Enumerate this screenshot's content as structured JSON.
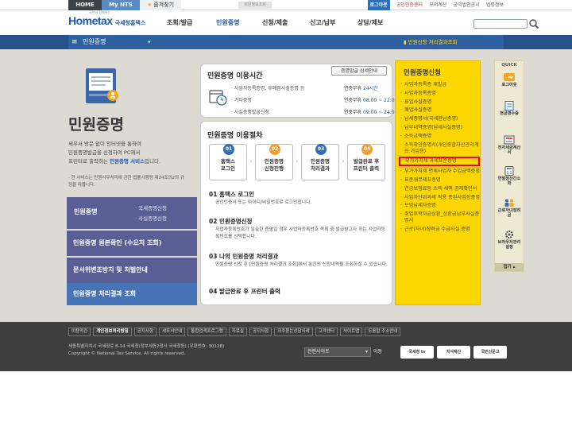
{
  "topbar": {
    "home": "HOME",
    "mynts": "My NTS",
    "favorites": "즐겨찾기",
    "user": "회원정보조회",
    "links": [
      "로그아웃",
      "공인인증센터",
      "모의계산",
      "공익법인공시",
      "법령정보"
    ]
  },
  "header": {
    "logo_small": "국민과 함께하는",
    "logo_main": "Hometax",
    "logo_sub": "국세청홈택스",
    "menu": [
      "조회/발급",
      "민원증명",
      "신청/제출",
      "신고/납부",
      "상담/제보"
    ]
  },
  "strip": {
    "title": "민원증명",
    "right": "민원신청 처리결과조회"
  },
  "hero": {
    "title": "민원증명",
    "desc_1": "세무서 방문 없이 인터넷을 통하여",
    "desc_2": "민원증명발급을 신청하여 PC에서",
    "desc_3_pre": "프린터로 출력하는 ",
    "desc_3_bold": "민원증명 서비스",
    "desc_3_post": "입니다.",
    "note": "· 현 서비스는 민원사무처리에 관한 법률시행령 제24조의2의 규정을 따릅니다."
  },
  "left_menu": {
    "item1": "민원증명",
    "item1_sub": [
      "· 국세증명신청",
      "· 사실증명신청"
    ],
    "item2": "민원증명 원본확인 (수요처 조회)",
    "item3": "문서위변조방지 및 처벌안내",
    "item4": "민원증명 처리결과 조회"
  },
  "usage": {
    "title": "민원증명 이용시간",
    "button": "증명발급 상세안내",
    "rows": [
      {
        "label": "· 사업자등록증명, 휴폐업사실증명 등",
        "val_pre": "연중무휴 ",
        "val_hl": "24시간"
      },
      {
        "label": "· 기타증명",
        "val_pre": "연중무휴 ",
        "val_hl": "08:00 ~ 22:00"
      },
      {
        "label": "· 사실증명발급신청",
        "val_pre": "연중무휴 ",
        "val_hl": "09:00 ~ 24:00"
      }
    ]
  },
  "procedure": {
    "title": "민원증명 이용절차",
    "steps": [
      {
        "num": "01",
        "l1": "홈택스",
        "l2": "로그인"
      },
      {
        "num": "02",
        "l1": "민원증명",
        "l2": "신청진행"
      },
      {
        "num": "03",
        "l1": "민원증명",
        "l2": "처리결과"
      },
      {
        "num": "04",
        "l1": "발급완료 후",
        "l2": "프린터 출력"
      }
    ],
    "items": [
      {
        "title": "01 홈택스 로그인",
        "desc": "공인인증서 또는 아이디/비밀번호로 로그인합니다."
      },
      {
        "title": "02 민원증명신청",
        "desc": "사업자등록번호가 필요한 증명일 경우 사업자등록번호 목록 중 발급받고자 하는 사업자등록번호를 선택합니다."
      },
      {
        "title": "03 나의 민원증명 처리결과",
        "desc": "민원증명 신청 후 [민원증명 처리결과 조회]에서 본인의 신청내역을 조회하실 수 있습니다."
      },
      {
        "title": "04 발급완료 후 프린터 출력",
        "desc": ""
      }
    ]
  },
  "cert_list": {
    "title": "민원증명신청",
    "items": [
      "사업자등록증 재발급",
      "사업자등록증명",
      "휴업사실증명",
      "폐업사실증명",
      "납세증명서(국세완납증명)",
      "납부내역증명(납세사실증명)",
      "소득금액증명",
      "소득확인증명서(개인종합자산관리계좌 가입용)",
      "부가가치세 과세표준증명",
      "부가가치세 면세사업자 수입금액증명",
      "표준재무제표증명",
      "연금보험료등 소득·세액 공제확인서",
      "사업자단위과세 적용 종된사업장증명",
      "모범납세자증명",
      "취업후학자금상환_상환금납부사실증명서",
      "근로(자녀)장려금 수급사실 증명"
    ],
    "highlight_index": 8
  },
  "quick": {
    "head": "QUICK",
    "items": [
      "로그아웃",
      "현금영수증",
      "전자세금계산서",
      "연말정산간소화",
      "근로자녀장려금",
      "브라우저관리설정"
    ],
    "close": "접기"
  },
  "footer": {
    "links": [
      "이용약관",
      "개인정보처리방침",
      "공지사항",
      "세무서안내",
      "통합검색프로그램",
      "자료실",
      "공지사항",
      "자주묻는상담사례",
      "고객센터",
      "사이트맵",
      "도움말 주소안내"
    ],
    "bold_index": 1,
    "addr_1": "세종특별자치시 국세청로 8-14 국세청(정부세종2청사 국세청동) (우편번호: 30128)",
    "addr_2": "Copyright © National Tax Service. All rights reserved.",
    "related": "관련사이트",
    "go": "이동",
    "banners": [
      "국세청 tv",
      "지식재산",
      "국민신문고"
    ]
  }
}
